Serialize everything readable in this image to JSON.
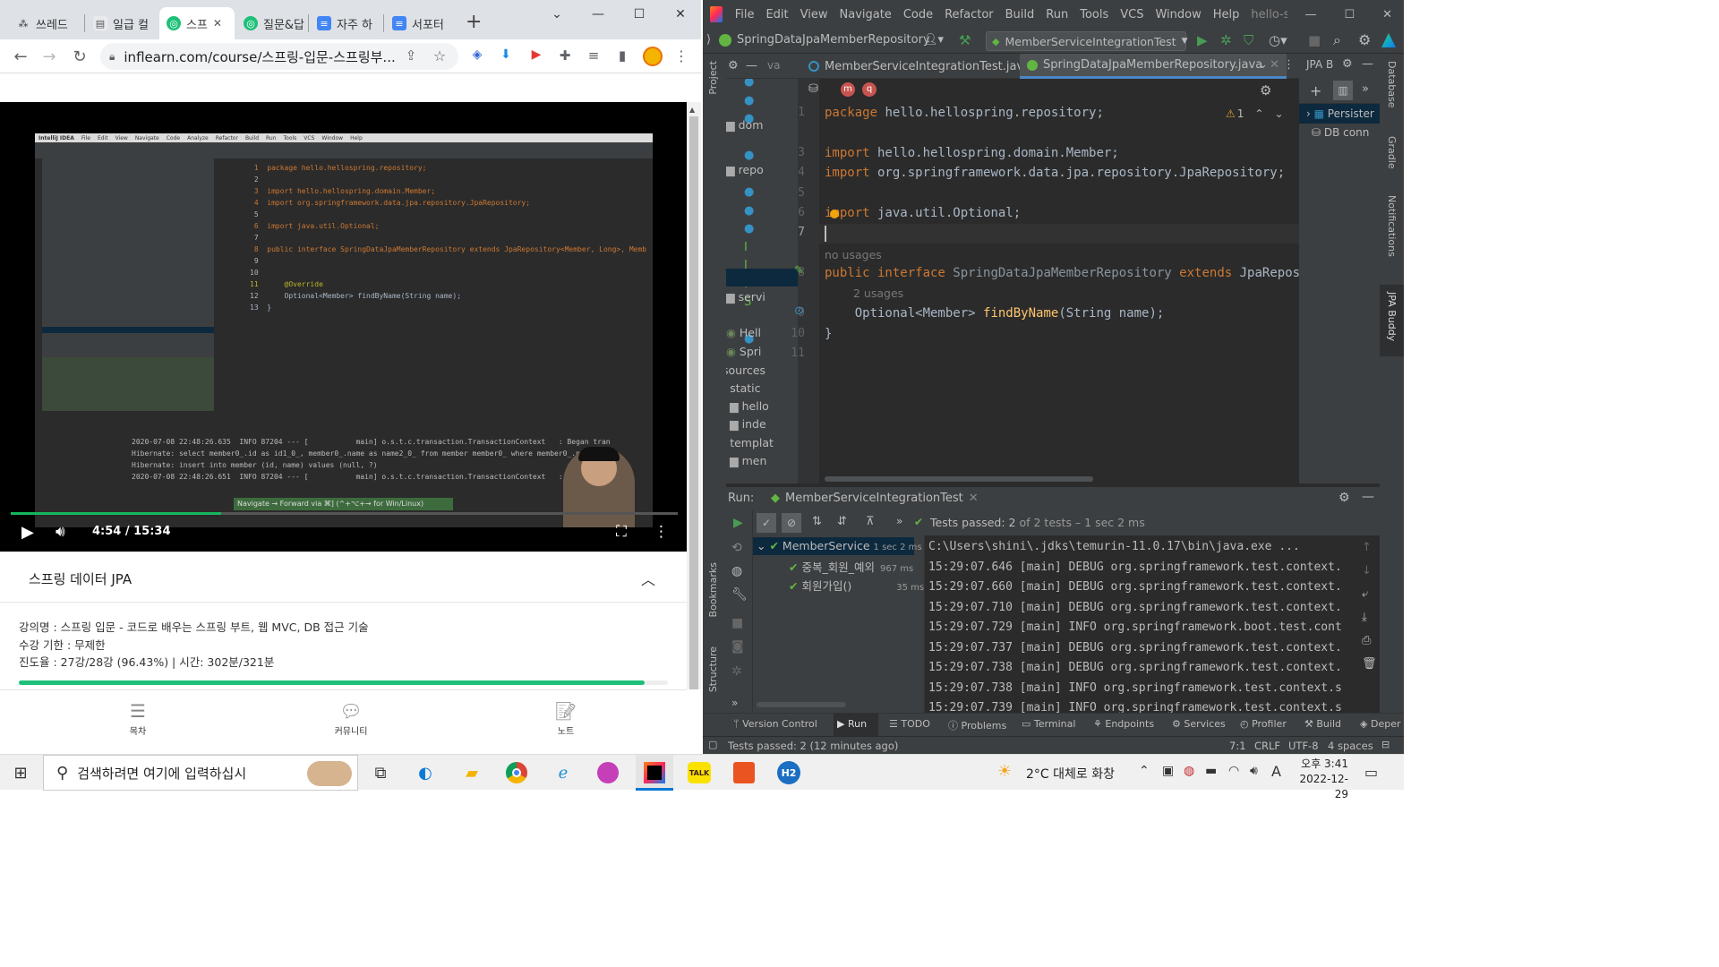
{
  "chrome": {
    "tabs": [
      {
        "label": "쓰레드",
        "icon": "threads-icon"
      },
      {
        "label": "일급 컬",
        "icon": "doc-icon"
      },
      {
        "label": "스프",
        "icon": "inflearn-icon"
      },
      {
        "label": "질문&답",
        "icon": "inflearn-icon"
      },
      {
        "label": "자주 하",
        "icon": "gdocs-icon"
      },
      {
        "label": "서포터",
        "icon": "gdocs-icon"
      }
    ],
    "new_tab": "+",
    "url": "inflearn.com/course/스프링-입문-스프링부...",
    "video": {
      "time": "4:54 / 15:34",
      "progress": 0.315,
      "inner_ide": {
        "menu": [
          "IntelliJ IDEA",
          "File",
          "Edit",
          "View",
          "Navigate",
          "Code",
          "Analyze",
          "Refactor",
          "Build",
          "Run",
          "Tools",
          "VCS",
          "Window",
          "Help"
        ],
        "code_lines": [
          "package hello.hellospring.repository;",
          "",
          "import hello.hellospring.domain.Member;",
          "import org.springframework.data.jpa.repository.JpaRepository;",
          "",
          "import java.util.Optional;",
          "",
          "public interface SpringDataJpaMemberRepository extends JpaRepository<Member, Long>, Membe",
          "",
          "",
          "    @Override",
          "    Optional<Member> findByName(String name);",
          "}"
        ],
        "console_lines": [
          "2020-07-08 22:48:26.635  INFO 87204 --- [           main] o.s.t.c.transaction.TransactionContext   : Began tran",
          "Hibernate: select member0_.id as id1_0_, member0_.name as name2_0_ from member member0_ where member0_.name=?",
          "Hibernate: insert into member (id, name) values (null, ?)",
          "2020-07-08 22:48:26.651  INFO 87204 --- [           main] o.s.t.c.transaction.TransactionContext   : Rolled back"
        ],
        "tooltip": "Navigate → Forward via ⌘] (^+⌥+→ for Win/Linux)"
      }
    },
    "course": {
      "section_title": "스프링 데이터 JPA",
      "lecture": "강의명 : 스프링 입문 - 코드로 배우는 스프링 부트, 웹 MVC, DB 접근 기술",
      "period": "수강 기한 : 무제한",
      "progress_text": "진도율 : 27강/28강 (96.43%) | 시간: 302분/321분",
      "progress": 0.9643,
      "bottom_nav": [
        {
          "label": "목차",
          "icon": "list-icon"
        },
        {
          "label": "커뮤니티",
          "icon": "chat-icon"
        },
        {
          "label": "노트",
          "icon": "note-icon"
        }
      ]
    }
  },
  "ide": {
    "menu": [
      "File",
      "Edit",
      "View",
      "Navigate",
      "Code",
      "Refactor",
      "Build",
      "Run",
      "Tools",
      "VCS",
      "Window",
      "Help"
    ],
    "project_title": "hello-spring",
    "breadcrumb": "SpringDataJpaMemberRepository",
    "run_config": "MemberServiceIntegrationTest",
    "editor_tabs": [
      {
        "label": "MemberServiceIntegrationTest.java",
        "active": false
      },
      {
        "label": "SpringDataJpaMemberRepository.java",
        "active": true
      }
    ],
    "right_panel_tab": "JPA B",
    "right_panel_items": [
      "Persister",
      "DB conn"
    ],
    "warning_count": "1",
    "project_tree": [
      "dom",
      "repo",
      "servi",
      "Hell",
      "Spri",
      "sources",
      "static",
      "hello",
      "inde",
      "templat",
      "men"
    ],
    "line_numbers": [
      "1",
      "2",
      "3",
      "4",
      "5",
      "6",
      "7",
      "",
      "8",
      "",
      "9",
      "10",
      "11"
    ],
    "code": {
      "l1_kw": "package",
      "l1_rest": " hello.hellospring.repository;",
      "l3_kw": "import",
      "l3_rest": " hello.hellospring.domain.Member;",
      "l4_kw": "import",
      "l4_rest": " org.springframework.data.jpa.repository.JpaRepository;",
      "l6_kw": "import",
      "l6_rest": " java.util.Optional;",
      "hint1": "no usages",
      "l8_kw1": "public",
      "l8_kw2": " interface",
      "l8_name": " SpringDataJpaMemberRepository",
      "l8_kw3": " extends",
      "l8_rest": " JpaReposit",
      "hint2": "2 usages",
      "l9_type": "    Optional<Member> ",
      "l9_fn": "findByName",
      "l9_rest": "(String name);",
      "l10": "}"
    },
    "run": {
      "label": "Run:",
      "config": "MemberServiceIntegrationTest",
      "tests_passed": "Tests passed:",
      "tests_count": "2",
      "tests_detail": "of 2 tests – 1 sec 2 ms",
      "tree": [
        {
          "label": "MemberService",
          "time": "1 sec 2 ms"
        },
        {
          "label": "중복_회원_예외",
          "time": "967 ms"
        },
        {
          "label": "회원가입()",
          "time": "35 ms"
        }
      ],
      "console": [
        "C:\\Users\\shini\\.jdks\\temurin-11.0.17\\bin\\java.exe ...",
        "15:29:07.646 [main] DEBUG org.springframework.test.context.",
        "15:29:07.660 [main] DEBUG org.springframework.test.context.",
        "15:29:07.710 [main] DEBUG org.springframework.test.context.",
        "15:29:07.729 [main] INFO org.springframework.boot.test.cont",
        "15:29:07.737 [main] DEBUG org.springframework.test.context.",
        "15:29:07.738 [main] DEBUG org.springframework.test.context.",
        "15:29:07.738 [main] INFO org.springframework.test.context.s",
        "15:29:07.739 [main] INFO org.springframework.test.context.s"
      ]
    },
    "left_strip": [
      "Project",
      "Bookmarks",
      "Structure"
    ],
    "right_strip": [
      "Database",
      "Gradle",
      "Notifications",
      "JPA Buddy"
    ],
    "bottom_tools": [
      "Version Control",
      "Run",
      "TODO",
      "Problems",
      "Terminal",
      "Endpoints",
      "Services",
      "Profiler",
      "Build",
      "Deper"
    ],
    "status": {
      "message": "Tests passed: 2 (12 minutes ago)",
      "pos": "7:1",
      "eol": "CRLF",
      "enc": "UTF-8",
      "indent": "4 spaces"
    }
  },
  "taskbar": {
    "search_placeholder": "검색하려면 여기에 입력하십시",
    "weather": "2°C  대체로 화창",
    "time": "오후 3:41",
    "date": "2022-12-29",
    "ime": "A"
  }
}
